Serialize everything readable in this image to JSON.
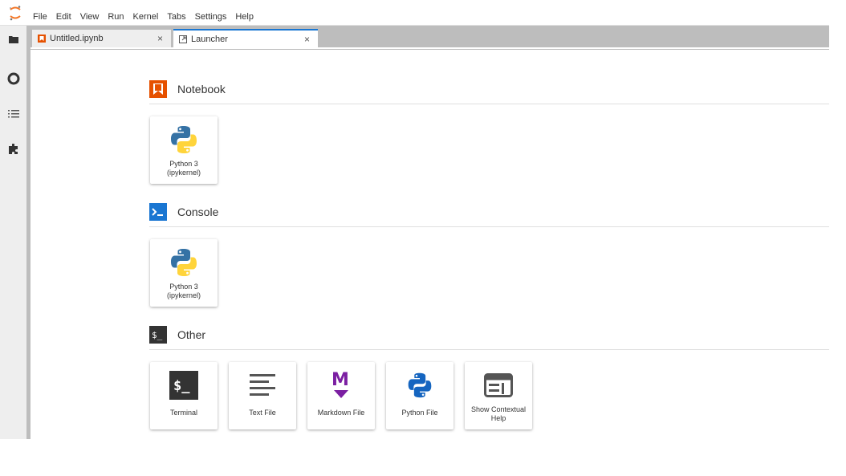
{
  "menubar": {
    "items": [
      "File",
      "Edit",
      "View",
      "Run",
      "Kernel",
      "Tabs",
      "Settings",
      "Help"
    ]
  },
  "tabs": [
    {
      "label": "Untitled.ipynb",
      "close": "×"
    },
    {
      "label": "Launcher",
      "close": "×"
    }
  ],
  "sections": {
    "notebook": {
      "title": "Notebook",
      "cards": [
        {
          "label": "Python 3\n(ipykernel)"
        }
      ]
    },
    "console": {
      "title": "Console",
      "cards": [
        {
          "label": "Python 3\n(ipykernel)"
        }
      ]
    },
    "other": {
      "title": "Other",
      "cards": [
        {
          "label": "Terminal"
        },
        {
          "label": "Text File"
        },
        {
          "label": "Markdown File"
        },
        {
          "label": "Python File"
        },
        {
          "label": "Show Contextual\nHelp"
        }
      ]
    }
  },
  "colors": {
    "accent": "#1976d2",
    "notebook_orange": "#e65100",
    "markdown_purple": "#7b1fa2",
    "python_blue": "#3572a5",
    "python_yellow": "#ffd43b",
    "terminal_dark": "#333333"
  }
}
